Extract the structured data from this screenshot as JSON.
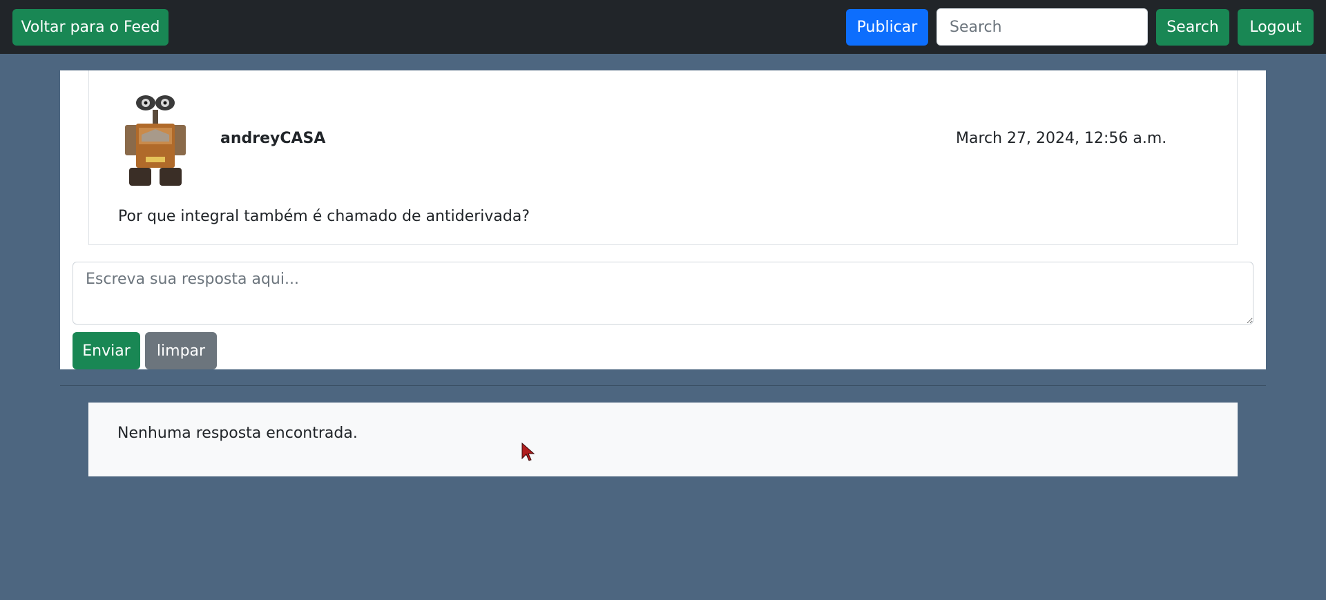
{
  "navbar": {
    "back_label": "Voltar para o Feed",
    "publish_label": "Publicar",
    "search_placeholder": "Search",
    "search_label": "Search",
    "logout_label": "Logout",
    "colors": {
      "bar": "#212529",
      "green": "#198754",
      "blue": "#0d6efd"
    }
  },
  "post": {
    "avatar_icon": "robot-avatar-icon",
    "username": "andreyCASA",
    "timestamp": "March 27, 2024, 12:56 a.m.",
    "text": "Por que integral também é chamado de antiderivada?"
  },
  "reply_form": {
    "placeholder": "Escreva sua resposta aqui...",
    "send_label": "Enviar",
    "clear_label": "limpar"
  },
  "replies": {
    "empty_message": "Nenhuma resposta encontrada."
  },
  "page": {
    "background": "#4d6680"
  }
}
